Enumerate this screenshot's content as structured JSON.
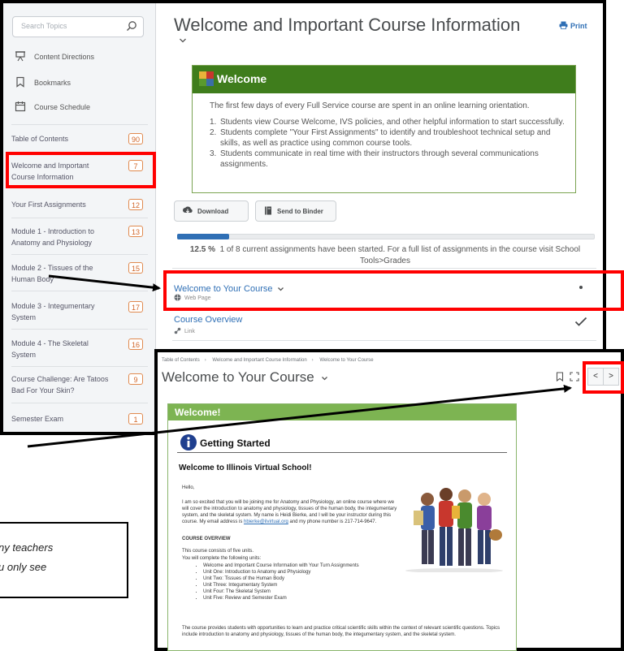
{
  "sidebar": {
    "search_placeholder": "Search Topics",
    "links": [
      {
        "label": "Content Directions",
        "icon": "easel-icon"
      },
      {
        "label": "Bookmarks",
        "icon": "bookmark-icon"
      },
      {
        "label": "Course Schedule",
        "icon": "calendar-icon"
      }
    ],
    "toc": [
      {
        "label": "Table of Contents",
        "count": "90"
      },
      {
        "label": "Welcome and Important Course Information",
        "count": "7"
      },
      {
        "label": "Your First Assignments",
        "count": "12"
      },
      {
        "label": "Module 1 - Introduction to Anatomy and Physiology",
        "count": "13"
      },
      {
        "label": "Module 2 - Tissues of the Human Body",
        "count": "15"
      },
      {
        "label": "Module 3 - Integumentary System",
        "count": "17"
      },
      {
        "label": "Module 4 - The Skeletal System",
        "count": "16"
      },
      {
        "label": "Course Challenge: Are Tatoos Bad For Your Skin?",
        "count": "9"
      },
      {
        "label": "Semester Exam",
        "count": "1"
      }
    ]
  },
  "main": {
    "title": "Welcome and Important Course Information",
    "print_label": "Print",
    "welcome": {
      "heading": "Welcome",
      "intro": "The first few days of every Full Service course are spent in an online learning orientation.",
      "items": [
        "Students view Course Welcome, IVS policies, and other helpful information to start successfully.",
        "Students complete \"Your First Assignments\" to identify and troubleshoot technical setup and skills, as well as practice using common course tools.",
        "Students communicate in real time with their instructors through several communications assignments."
      ]
    },
    "download_label": "Download",
    "binder_label": "Send to Binder",
    "progress": {
      "fraction": 0.125,
      "percent_label": "12.5 %",
      "text": "1 of 8 current assignments have been started. For a full list of assignments in the course visit School Tools>Grades"
    },
    "topics": [
      {
        "title": "Welcome to Your Course",
        "type": "Web Page"
      },
      {
        "title": "Course Overview",
        "type": "Link"
      }
    ]
  },
  "viewer": {
    "breadcrumb": [
      "Table of Contents",
      "Welcome and Important Course Information",
      "Welcome to Your Course"
    ],
    "title": "Welcome to Your Course",
    "prev": "<",
    "next": ">",
    "banner": "Welcome!",
    "getting_started": "Getting Started",
    "heading": "Welcome to Illinois Virtual School!",
    "hello": "Hello,",
    "para1": "I am so excited that you will be joining me for Anatomy and Physiology, an online course where we will cover the introduction to anatomy and physiology, tissues of the human body, the integumentary system, and the skeletal system.  My name is Heidi Bierke, and I will be your instructor during this course.  My email address is",
    "email": "hbierke@ilvirtual.org",
    "para1b": "and my phone number is 217-714-9647.",
    "overview_heading": "COURSE OVERVIEW",
    "overview_1": "This course consists of five units.",
    "overview_2": "You will complete the following units:",
    "units": [
      "Welcome and Important Course Information with Your Turn Assignments",
      "Unit One: Introduction to Anatomy and Physiology",
      "Unit Two: Tissues of the Human Body",
      "Unit Three: Integumentary System",
      "Unit Four: The Skeletal System",
      "Unit Five: Review and Semester Exam"
    ],
    "closing": "The course provides students with opportunities to learn and practice critical scientific skills within the context of relevant scientific questions. Topics include introduction to anatomy and physiology, tissues of the human body, the integumentary system, and the skeletal system."
  },
  "note": {
    "line1": "ny teachers",
    "line2": "u only see"
  },
  "colors": {
    "accent": "#2f6fb5",
    "green_header": "#3f7d1c",
    "green_banner": "#7db452",
    "highlight": "#ff0000",
    "badge": "#d0662a"
  }
}
